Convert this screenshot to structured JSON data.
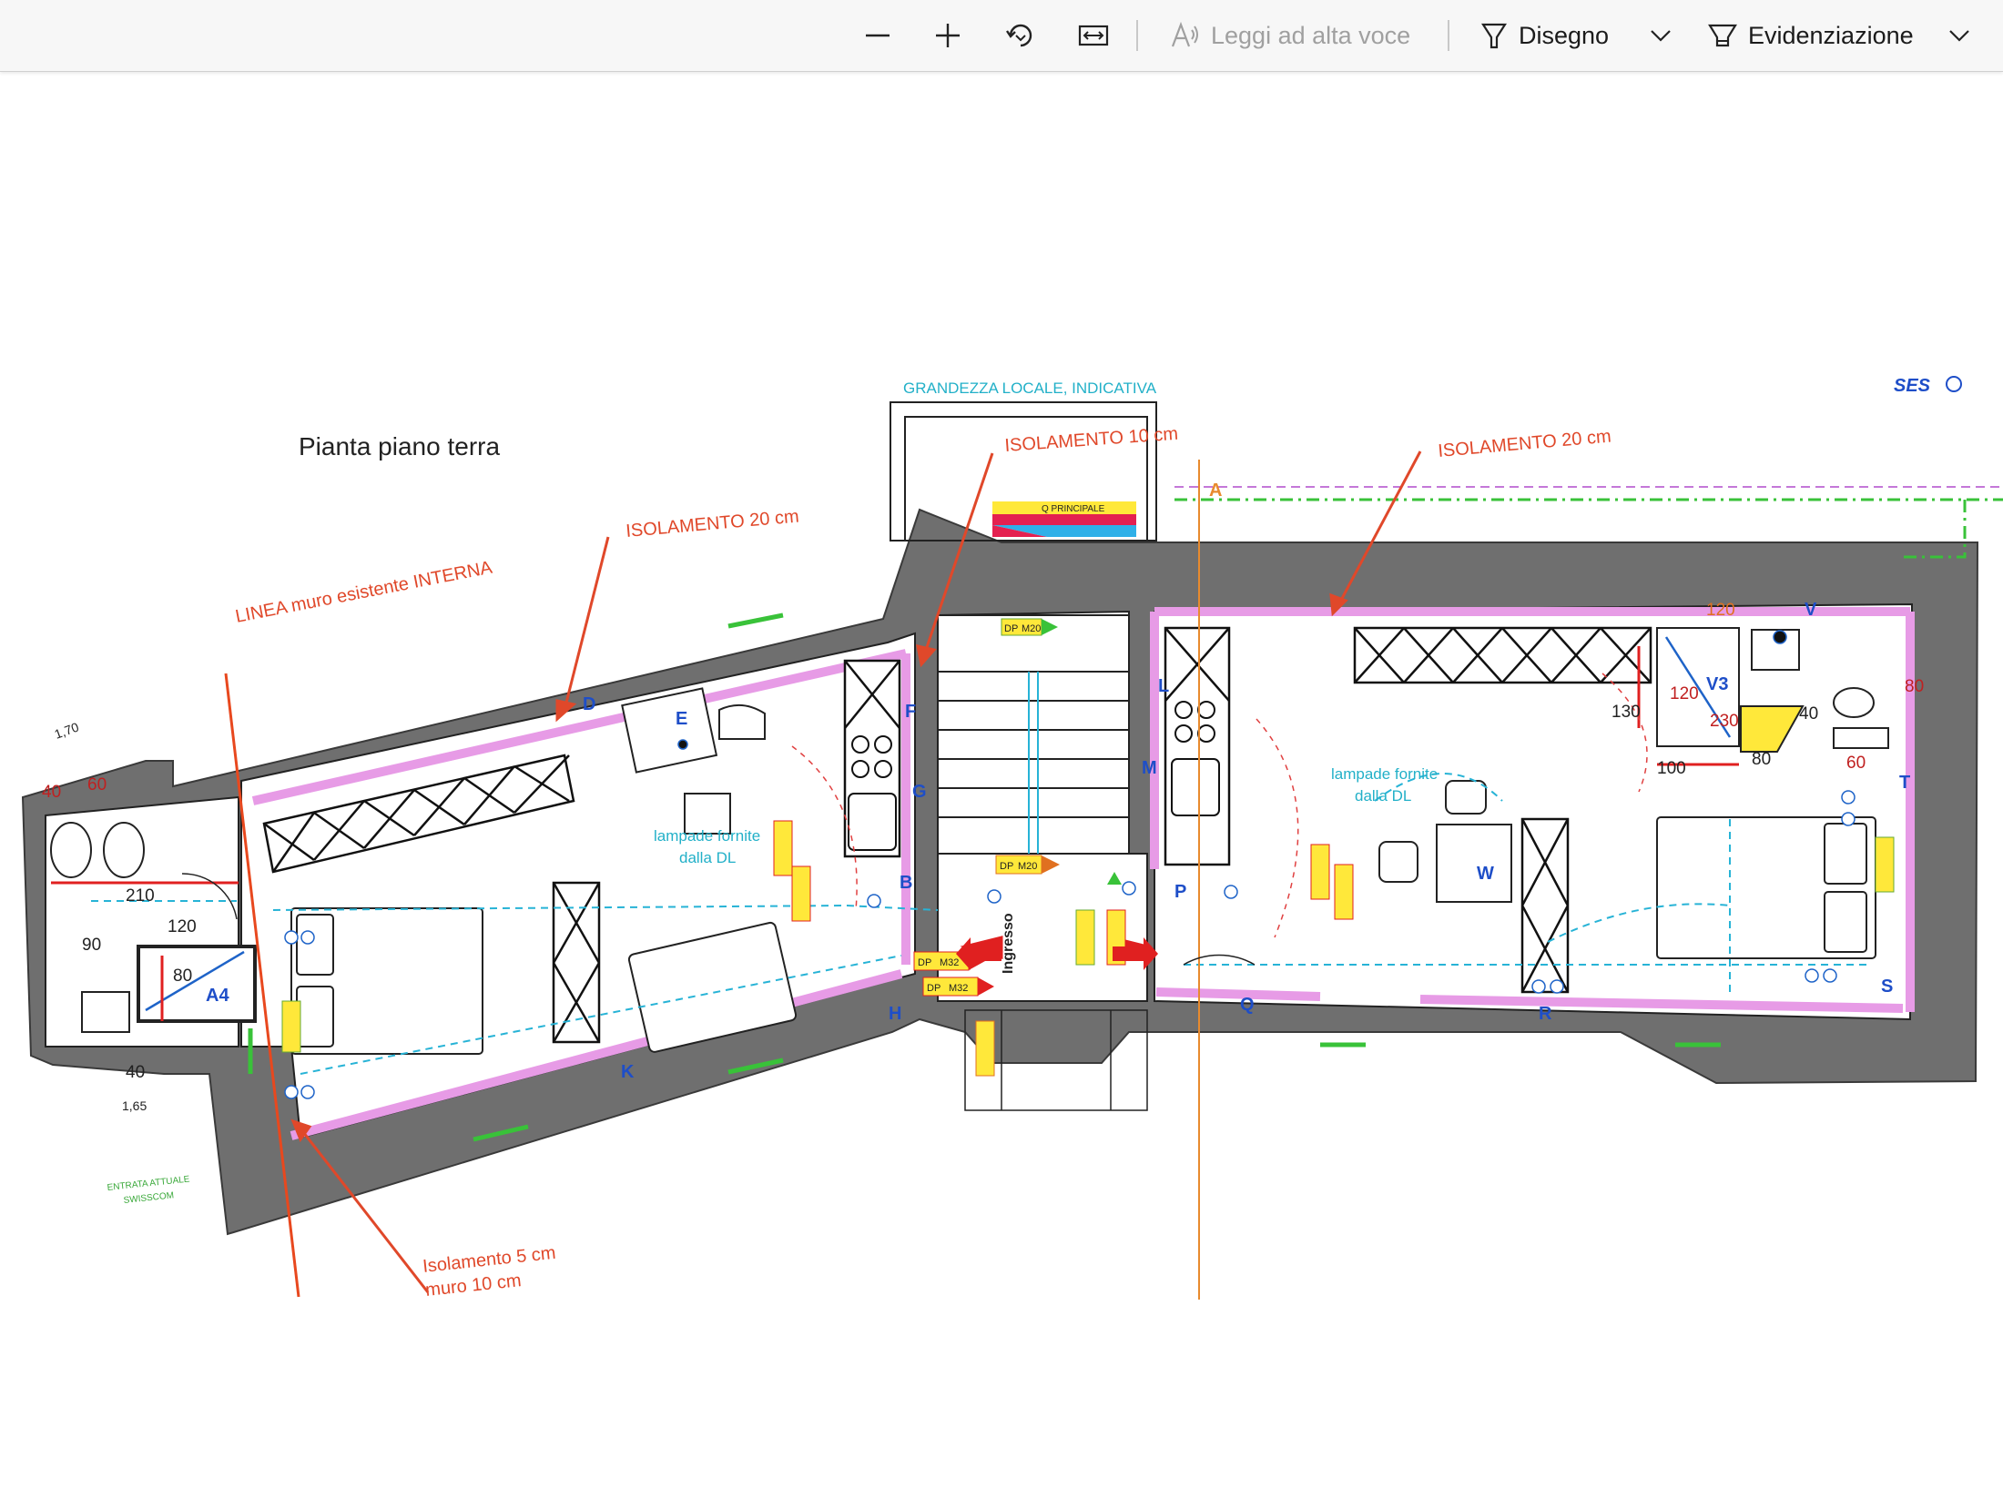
{
  "toolbar": {
    "zoom_out_icon": "minus-icon",
    "zoom_in_icon": "plus-icon",
    "rotate_icon": "rotate-icon",
    "fit_width_icon": "fit-width-icon",
    "read_aloud_label": "Leggi ad alta voce",
    "draw_label": "Disegno",
    "highlight_label": "Evidenziazione"
  },
  "plan": {
    "title": "Pianta piano terra",
    "annotations": {
      "room_size": "GRANDEZZA LOCALE, INDICATIVA",
      "insulation_10": "ISOLAMENTO 10 cm",
      "insulation_20_right": "ISOLAMENTO 20 cm",
      "insulation_20_left": "ISOLAMENTO 20 cm",
      "internal_wall": "LINEA muro esistente INTERNA",
      "insulation_5": "Isolamento 5 cm",
      "wall_10": "muro 10 cm",
      "lamps_left_1": "lampade fornite",
      "lamps_left_2": "dalla DL",
      "lamps_right_1": "lampade fornite",
      "lamps_right_2": "dalla DL",
      "entrance": "Ingresso",
      "panel": "Q PRINCIPALE",
      "entrata_1": "ENTRATA ATTUALE",
      "entrata_2": "SWISSCOM"
    },
    "dimensions": {
      "d40a": "40",
      "d60": "60",
      "d210": "210",
      "d120a": "120",
      "d90": "90",
      "d80a": "80",
      "d40b": "40",
      "d165": "1,65",
      "d170": "1,70",
      "d120b": "120",
      "d130": "130",
      "d120c": "120",
      "d230": "230",
      "d40c": "40",
      "d100": "100",
      "d80b": "80",
      "d60b": "60",
      "d80c": "80"
    },
    "markers": {
      "A4": "A4",
      "D": "D",
      "E": "E",
      "F": "F",
      "G": "G",
      "B": "B",
      "H": "H",
      "K": "K",
      "L": "L",
      "M": "M",
      "P": "P",
      "Q": "Q",
      "R": "R",
      "S": "S",
      "T": "T",
      "V": "V",
      "V3": "V3",
      "W": "W",
      "A": "A"
    },
    "tags": {
      "dp1": "DP",
      "m1": "M20",
      "dp2": "DP",
      "m2": "M20",
      "dp3": "DP",
      "m3": "M32",
      "dp4": "DP",
      "m4": "M32"
    },
    "logo_text": "SES"
  }
}
